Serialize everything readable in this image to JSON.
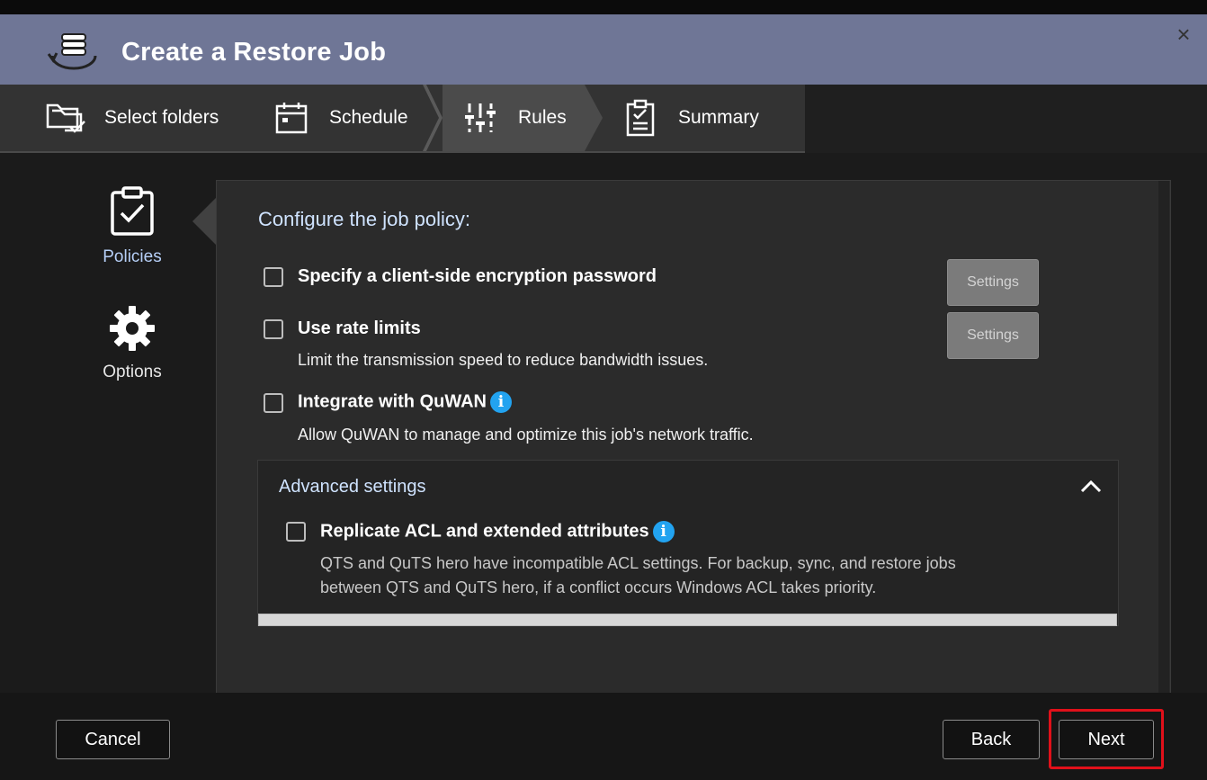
{
  "window": {
    "title": "Create a Restore Job",
    "close_label": "×"
  },
  "steps": [
    {
      "label": "Select folders",
      "icon": "folders-check-icon"
    },
    {
      "label": "Schedule",
      "icon": "calendar-icon"
    },
    {
      "label": "Rules",
      "icon": "sliders-icon",
      "active": true
    },
    {
      "label": "Summary",
      "icon": "clipboard-list-icon"
    }
  ],
  "sidebar": {
    "items": [
      {
        "label": "Policies",
        "icon": "clipboard-check-icon",
        "active": true
      },
      {
        "label": "Options",
        "icon": "gear-icon"
      }
    ]
  },
  "panel": {
    "heading": "Configure the job policy:",
    "options": [
      {
        "title": "Specify a client-side encryption password",
        "desc": "",
        "checked": false
      },
      {
        "title": "Use rate limits",
        "desc": "Limit the transmission speed to reduce bandwidth issues.",
        "checked": false
      },
      {
        "title": "Integrate with QuWAN",
        "desc": "Allow QuWAN to manage and optimize this job's network traffic.",
        "checked": false
      }
    ],
    "settings_label": "Settings",
    "info_glyph": "i",
    "advanced": {
      "title": "Advanced settings",
      "option_title": "Replicate ACL and extended attributes",
      "option_desc_1": "QTS and QuTS hero have incompatible ACL settings. For backup, sync, and restore jobs",
      "option_desc_2": "between QTS and QuTS hero, if a conflict occurs Windows ACL takes priority."
    }
  },
  "footer": {
    "cancel": "Cancel",
    "back": "Back",
    "next": "Next"
  },
  "colors": {
    "titlebar": "#6f7696",
    "info": "#22a3f0",
    "highlight": "#e0101a",
    "link_text": "#cfe3ff"
  }
}
